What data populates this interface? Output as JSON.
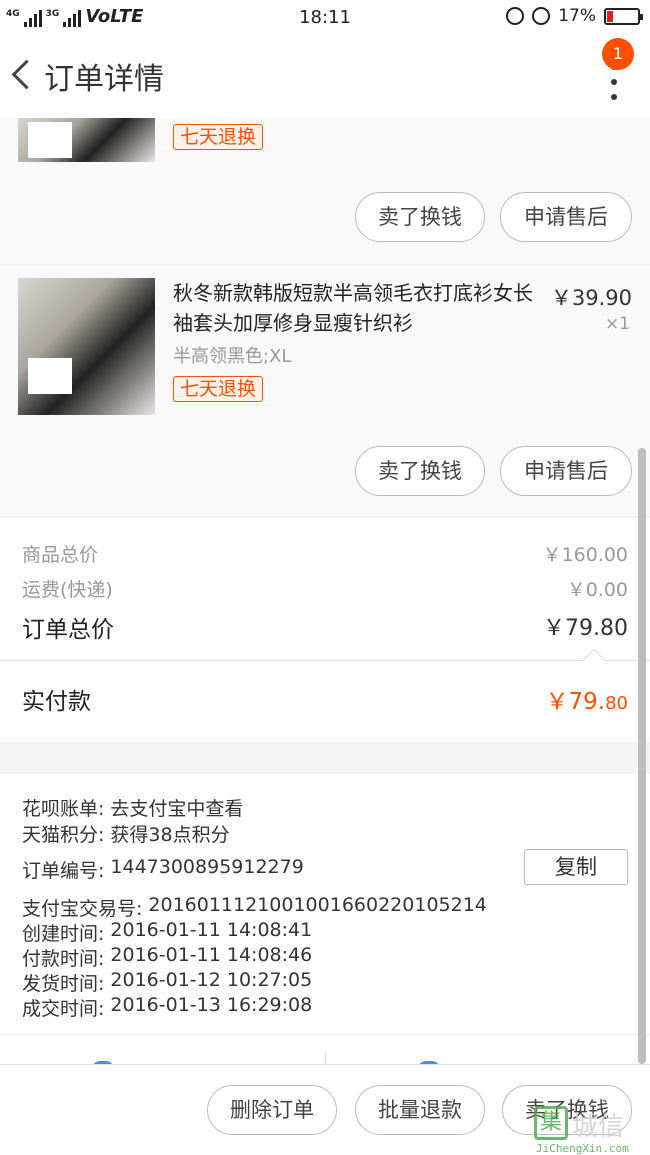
{
  "status_bar": {
    "network_left": "4G",
    "network_right": "3G",
    "volte": "VoLTE",
    "time": "18:11",
    "battery": "17%"
  },
  "header": {
    "title": "订单详情",
    "notification_count": "1"
  },
  "items": [
    {
      "tag": "七天退换",
      "buttons": [
        "卖了换钱",
        "申请售后"
      ]
    },
    {
      "title": "秋冬新款韩版短款半高领毛衣打底衫女长袖套头加厚修身显瘦针织衫",
      "sku": "半高领黑色;XL",
      "price": "￥39.90",
      "quantity": "×1",
      "tag": "七天退换",
      "buttons": [
        "卖了换钱",
        "申请售后"
      ]
    }
  ],
  "totals": {
    "goods_label": "商品总价",
    "goods_value": "￥160.00",
    "shipping_label": "运费(快递)",
    "shipping_value": "￥0.00",
    "order_total_label": "订单总价",
    "order_total_value": "￥79.80",
    "paid_label": "实付款",
    "paid_value_main": "￥79.",
    "paid_value_cents": "80"
  },
  "order_info": {
    "huabei_label": "花呗账单:",
    "huabei_value": "去支付宝中查看",
    "tmall_points_label": "天猫积分:",
    "tmall_points_value": "获得38点积分",
    "order_no_label": "订单编号:",
    "order_no_value": "1447300895912279",
    "copy_label": "复制",
    "alipay_no_label": "支付宝交易号:",
    "alipay_no_value": "2016011121001001660220105214",
    "created_label": "创建时间:",
    "created_value": "2016-01-11 14:08:41",
    "paid_time_label": "付款时间:",
    "paid_time_value": "2016-01-11 14:08:46",
    "shipped_label": "发货时间:",
    "shipped_value": "2016-01-12 10:27:05",
    "closed_label": "成交时间:",
    "closed_value": "2016-01-13 16:29:08"
  },
  "bottom_bar": {
    "delete_label": "删除订单",
    "batch_refund_label": "批量退款",
    "sell_label": "卖了换钱"
  },
  "watermark": {
    "logo": "集",
    "text": "城信",
    "site": "JiChengXin.com"
  }
}
